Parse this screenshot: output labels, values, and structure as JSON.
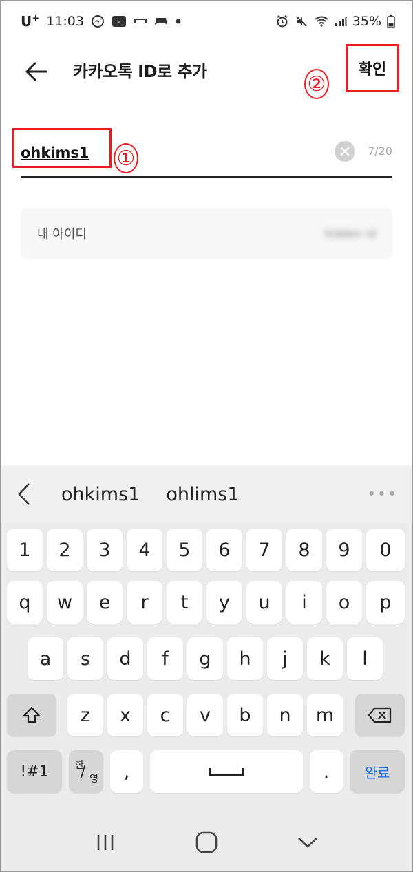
{
  "status_bar": {
    "carrier": "U",
    "carrier_sup": "+",
    "time": "11:03",
    "battery": "35%"
  },
  "header": {
    "title": "카카오톡 ID로 추가",
    "confirm_label": "확인",
    "annotation_2": "②"
  },
  "id_field": {
    "value": "ohkims1",
    "char_count": "7/20",
    "annotation_1": "①"
  },
  "my_id": {
    "label": "내 아이디",
    "value": "hidden id"
  },
  "keyboard": {
    "suggestions": [
      "ohkims1",
      "ohlims1"
    ],
    "more": "•••",
    "row_numbers": [
      "1",
      "2",
      "3",
      "4",
      "5",
      "6",
      "7",
      "8",
      "9",
      "0"
    ],
    "row_1": [
      "q",
      "w",
      "e",
      "r",
      "t",
      "y",
      "u",
      "i",
      "o",
      "p"
    ],
    "row_2": [
      "a",
      "s",
      "d",
      "f",
      "g",
      "h",
      "j",
      "k",
      "l"
    ],
    "row_3": [
      "z",
      "x",
      "c",
      "v",
      "b",
      "n",
      "m"
    ],
    "symbols_label": "!#1",
    "hanyeong_top": "한",
    "hanyeong_bottom": "영",
    "comma": ",",
    "period": ".",
    "done_label": "완료"
  },
  "colors": {
    "annotation": "#ee1c24",
    "done_key": "#1a73e8"
  }
}
